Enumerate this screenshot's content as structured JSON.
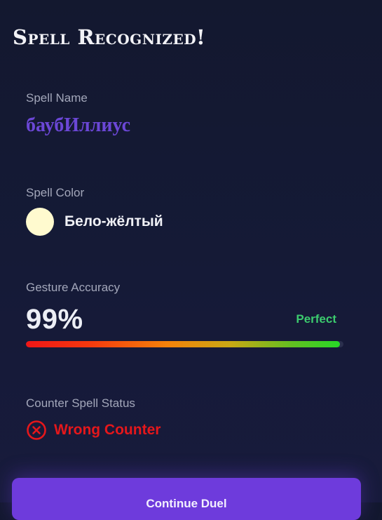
{
  "header": {
    "title": "Spell Recognized!"
  },
  "spell": {
    "name_label": "Spell Name",
    "name": "баубИллиус",
    "name_color": "#6b47d6"
  },
  "color": {
    "label": "Spell Color",
    "name": "Бело-жёлтый",
    "swatch_hex": "#fffacf"
  },
  "gesture": {
    "label": "Gesture Accuracy",
    "value_text": "99%",
    "value": 99,
    "rating": "Perfect",
    "rating_color": "#3ccb6e"
  },
  "counter": {
    "label": "Counter Spell Status",
    "status": "Wrong Counter",
    "status_color": "#e5171b",
    "icon": "x-circle-icon"
  },
  "actions": {
    "continue_label": "Continue Duel"
  },
  "theme": {
    "background": "#13182f",
    "accent": "#6e3bdc"
  }
}
